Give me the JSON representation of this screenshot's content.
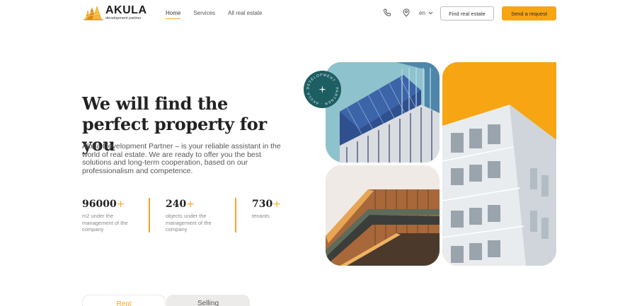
{
  "brand": {
    "name": "AKULA",
    "tagline": "development partner",
    "accent": "#f7a513",
    "teal": "#1d5e63"
  },
  "nav": {
    "items": [
      {
        "label": "Home",
        "active": true
      },
      {
        "label": "Services",
        "active": false
      },
      {
        "label": "All real estate",
        "active": false
      }
    ]
  },
  "header": {
    "phone_icon": "phone-icon",
    "location_icon": "location-pin-icon",
    "language": "en",
    "find_button": "Find real estate",
    "send_button": "Send a request"
  },
  "hero": {
    "title": "We will find the perfect property for you",
    "description": "Akula Development Partner – is your reliable assistant in the world of real estate. We are ready to offer you the best solutions and long-term cooperation, based on our professionalism and competence."
  },
  "stats": [
    {
      "number": "96000",
      "plus": "+",
      "label": "m2 under the management of the company"
    },
    {
      "number": "240",
      "plus": "+",
      "label": "objects under the management of the company"
    },
    {
      "number": "730",
      "plus": "+",
      "label": "tenants"
    }
  ],
  "badge": {
    "text": "DEVELOPMENT · PARTNER · AKULA ·"
  },
  "tabs": [
    {
      "label": "Rent",
      "active": true
    },
    {
      "label": "Selling",
      "active": false
    }
  ]
}
